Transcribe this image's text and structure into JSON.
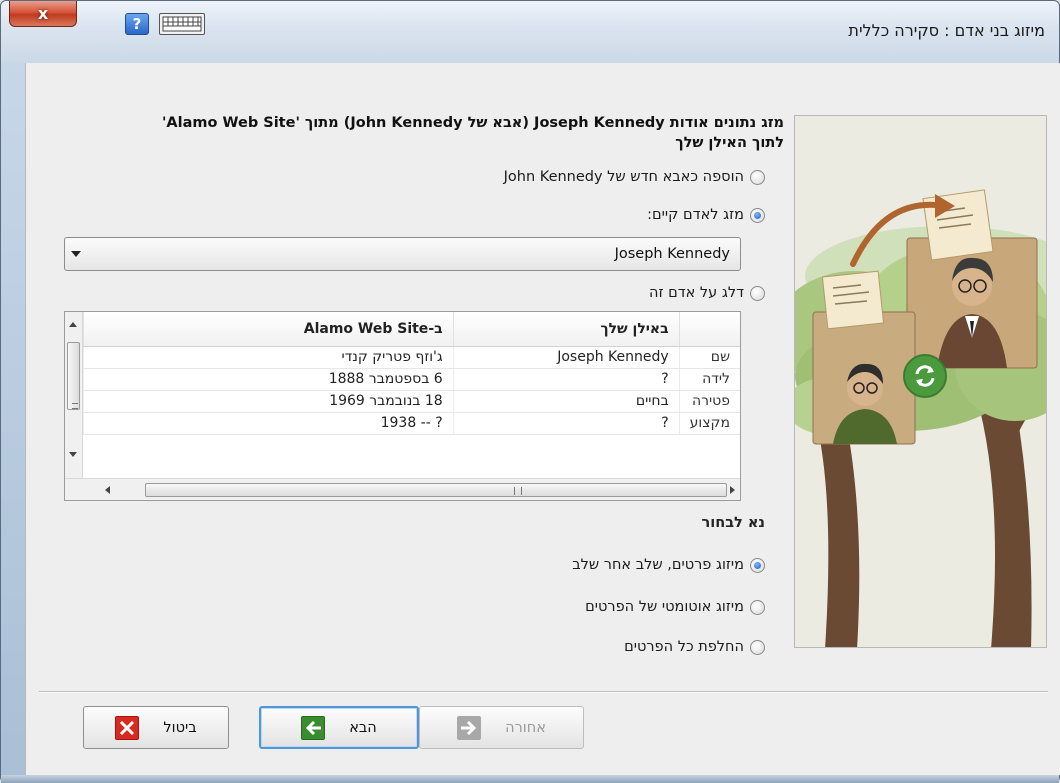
{
  "window": {
    "title": "מיזוג בני אדם : סקירה כללית",
    "close_label": "x",
    "help_label": "?"
  },
  "heading": {
    "line1": "מזג נתונים אודות Joseph Kennedy (אבא של John Kennedy) מתוך 'Alamo Web Site'",
    "line2": "לתוך האילן שלך"
  },
  "options": {
    "add_new": "הוספה כאבא חדש של John Kennedy",
    "merge_existing": "מזג לאדם קיים:",
    "skip": "דלג על אדם זה",
    "selected": "merge_existing"
  },
  "dropdown": {
    "value": "Joseph Kennedy"
  },
  "table": {
    "headers": [
      "",
      "באילן שלך",
      "ב-Alamo Web Site"
    ],
    "rows": [
      {
        "label": "שם",
        "mine": "Joseph Kennedy",
        "site": "ג'וזף פטריק קנדי"
      },
      {
        "label": "לידה",
        "mine": "?",
        "site": "6 בספטמבר 1888"
      },
      {
        "label": "פטירה",
        "mine": "בחיים",
        "site": "18 בנובמבר 1969"
      },
      {
        "label": "מקצוע",
        "mine": "?",
        "site": "? -- 1938"
      }
    ]
  },
  "choose": {
    "title": "נא לבחור",
    "step_by_step": "מיזוג פרטים, שלב אחר שלב",
    "automatic": "מיזוג אוטומטי של הפרטים",
    "replace_all": "החלפת כל הפרטים",
    "selected": "step_by_step"
  },
  "buttons": {
    "back": "אחורה",
    "next": "הבא",
    "cancel": "ביטול"
  },
  "colors": {
    "accent": "#3a8d2e",
    "cancel_red": "#d62b1e",
    "disabled_gray": "#9a9a9a"
  },
  "icons": {
    "close": "close-icon",
    "help": "help-icon",
    "keyboard": "keyboard-icon",
    "sync": "sync-icon",
    "arrow_right": "arrow-right-icon",
    "arrow_left": "arrow-left-icon",
    "cancel": "cancel-x-icon"
  }
}
